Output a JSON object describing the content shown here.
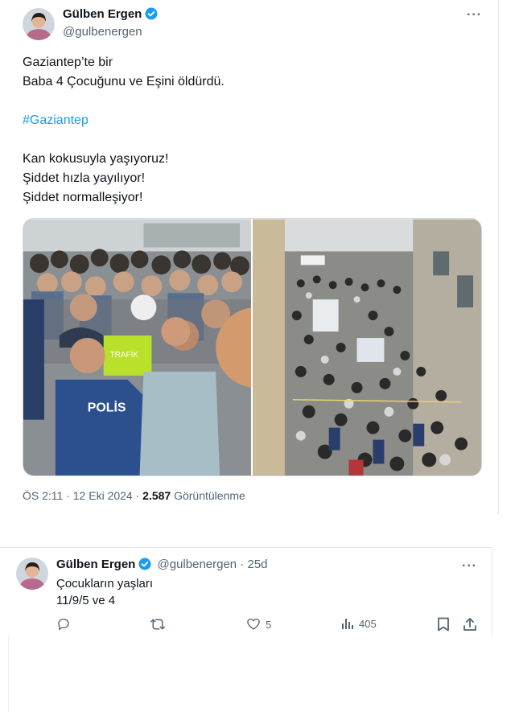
{
  "tweet": {
    "author_name": "Gülben Ergen",
    "author_handle": "@gulbenergen",
    "text_lines": [
      "Gaziantep’te bir",
      "Baba 4 Çocuğunu ve Eşini öldürdü."
    ],
    "hashtag": "#Gaziantep",
    "text_lines_2": [
      "Kan kokusuyla yaşıyoruz!",
      "Şiddet hızla yayılıyor!",
      "Şiddet normalleşiyor!"
    ],
    "timestamp": "ÖS 2:11 · 12 Eki 2024 · ",
    "views_count": "2.587",
    "views_label": "Görüntülenme",
    "more_label": "···",
    "image_text_polis": "POLİS",
    "image_text_trafik": "TRAFİK"
  },
  "reply": {
    "author_name": "Gülben Ergen",
    "author_handle": "@gulbenergen",
    "age": "· 25d",
    "line1": "Çocukların yaşları",
    "line2": "11/9/5 ve 4",
    "more_label": "···",
    "actions": {
      "likes": "5",
      "views": "405"
    }
  },
  "icons": {
    "verified": "verified-badge-icon",
    "reply": "reply-icon",
    "retweet": "retweet-icon",
    "like": "heart-icon",
    "views": "views-chart-icon",
    "bookmark": "bookmark-icon",
    "share": "share-icon"
  },
  "colors": {
    "accent": "#1d9bf0",
    "secondary_text": "#536471",
    "primary_text": "#0f1419"
  }
}
